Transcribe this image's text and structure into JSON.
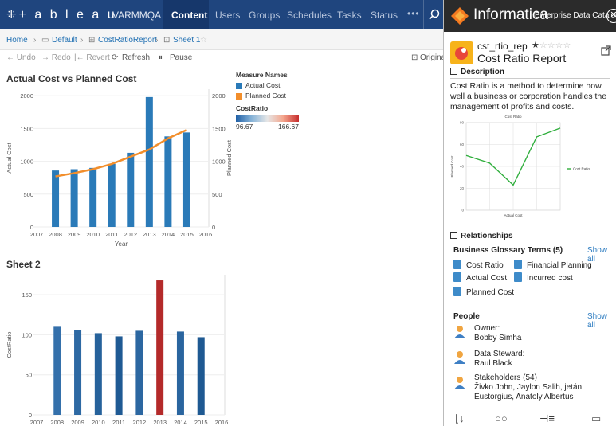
{
  "tableau": {
    "logo": "+ a b l e a u",
    "site": "VARMMQA ⊙",
    "nav": [
      "Content",
      "Users",
      "Groups",
      "Schedules",
      "Tasks",
      "Status"
    ],
    "more": "•••",
    "breadcrumb": {
      "home": "Home",
      "project": "Default",
      "workbook": "CostRatioReport",
      "sheet": "Sheet 1",
      "sep": "›"
    },
    "toolbar": {
      "undo": "← Undo",
      "redo": "→ Redo",
      "revert": "|← Revert",
      "refresh": "Refresh",
      "pause": "Pause",
      "original": "Original"
    },
    "legend": {
      "measure_header": "Measure Names",
      "actual": "Actual Cost",
      "planned": "Planned Cost",
      "ratio_header": "CostRatio",
      "ratio_min": "96.67",
      "ratio_max": "166.67"
    }
  },
  "chart_data": [
    {
      "type": "bar",
      "title": "Actual Cost vs Planned Cost",
      "xlabel": "Year",
      "ylabel": "Actual Cost",
      "y2label": "Planned Cost",
      "x_ticks": [
        "2007",
        "2008",
        "2009",
        "2010",
        "2011",
        "2012",
        "2013",
        "2014",
        "2015",
        "2016"
      ],
      "categories": [
        "2008",
        "2009",
        "2010",
        "2011",
        "2012",
        "2013",
        "2014",
        "2015"
      ],
      "y_ticks": [
        "0",
        "500",
        "1000",
        "1500",
        "2000"
      ],
      "y2_ticks": [
        "0",
        "500",
        "1000",
        "1500",
        "2000"
      ],
      "ylim": [
        0,
        2100
      ],
      "series": [
        {
          "name": "Actual Cost",
          "type": "bar",
          "color": "#2a7ab8",
          "values": [
            860,
            880,
            900,
            960,
            1130,
            1980,
            1380,
            1440
          ]
        },
        {
          "name": "Planned Cost",
          "type": "line",
          "color": "#f28e2b",
          "values": [
            770,
            820,
            880,
            960,
            1070,
            1180,
            1350,
            1480
          ]
        }
      ]
    },
    {
      "type": "bar",
      "title": "Sheet 2",
      "ylabel": "CostRatio",
      "x_ticks": [
        "2007",
        "2008",
        "2009",
        "2010",
        "2011",
        "2012",
        "2013",
        "2014",
        "2015",
        "2016"
      ],
      "categories": [
        "2008",
        "2009",
        "2010",
        "2011",
        "2012",
        "2013",
        "2014",
        "2015"
      ],
      "y_ticks": [
        "0",
        "50",
        "100",
        "150"
      ],
      "ylim": [
        0,
        175
      ],
      "values": [
        110,
        106,
        102,
        98,
        105,
        168,
        104,
        97
      ]
    }
  ],
  "informatica": {
    "brand": "Informatica",
    "product": "Enterprise Data Catalog",
    "close": "✕",
    "asset_name": "cst_rtio_rep",
    "asset_title": "Cost Ratio Report",
    "stars_filled": "★",
    "stars_empty": "☆☆☆☆",
    "description_label": "Description",
    "description": "Cost Ratio is a method to determine how well a business or corporation handles the management of profits and costs.",
    "relationships_label": "Relationships",
    "glossary_label": "Business Glossary Terms (5)",
    "glossary_show_all": "Show all",
    "terms": [
      "Cost Ratio",
      "Financial Planning",
      "Actual Cost",
      "Incurred cost",
      "Planned Cost"
    ],
    "people_label": "People",
    "people_show_all": "Show all",
    "owner_role": "Owner:",
    "owner_name": "Bobby Simha",
    "steward_role": "Data Steward:",
    "steward_name": "Raul Black",
    "stakeholders_role": "Stakeholders (54)",
    "stakeholders_names": "Živko John, Jaylon Salih, jetán Eustorgius, Anatoly Albertus"
  },
  "mini_chart_data": {
    "type": "line",
    "title": "Cost Ratio",
    "xlabel": "Actual Cost",
    "ylabel": "Planned Cost",
    "legend": "Cost Ratio",
    "y_ticks": [
      "0",
      "20",
      "40",
      "60",
      "80"
    ],
    "ylim": [
      0,
      80
    ],
    "values": [
      50,
      43,
      23,
      67,
      75
    ],
    "color": "#2fae3c"
  }
}
